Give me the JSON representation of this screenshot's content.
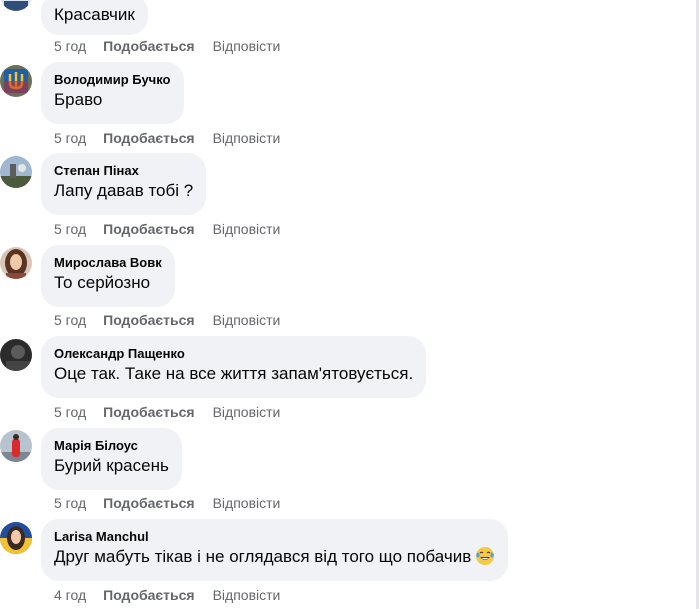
{
  "comments": [
    {
      "author": "",
      "text": "Красавчик",
      "time": "5 год",
      "like": "Подобається",
      "reply": "Відповісти",
      "avatar": "blue-white-avatar"
    },
    {
      "author": "Володимир Бучко",
      "text": "Браво",
      "time": "5 год",
      "like": "Подобається",
      "reply": "Відповісти",
      "avatar": "trident-avatar"
    },
    {
      "author": "Степан Пінах",
      "text": "Лапу давав тобі ?",
      "time": "5 год",
      "like": "Подобається",
      "reply": "Відповісти",
      "avatar": "landscape-avatar"
    },
    {
      "author": "Мирослава Вовк",
      "text": "То серйозно",
      "time": "5 год",
      "like": "Подобається",
      "reply": "Відповісти",
      "avatar": "woman-portrait-avatar"
    },
    {
      "author": "Олександр Пащенко",
      "text": "Оце так. Таке на все життя запам'ятовується.",
      "time": "5 год",
      "like": "Подобається",
      "reply": "Відповісти",
      "avatar": "dark-portrait-avatar"
    },
    {
      "author": "Марія Білоус",
      "text": "Бурий красень",
      "time": "5 год",
      "like": "Подобається",
      "reply": "Відповісти",
      "avatar": "red-figure-avatar"
    },
    {
      "author": "Larisa Manchul",
      "text": "Друг мабуть тікав і не оглядався від того що побачив",
      "time": "4 год",
      "like": "Подобається",
      "reply": "Відповісти",
      "avatar": "woman-yellow-blue-avatar",
      "emoji": "laughing-tears-emoji"
    }
  ]
}
